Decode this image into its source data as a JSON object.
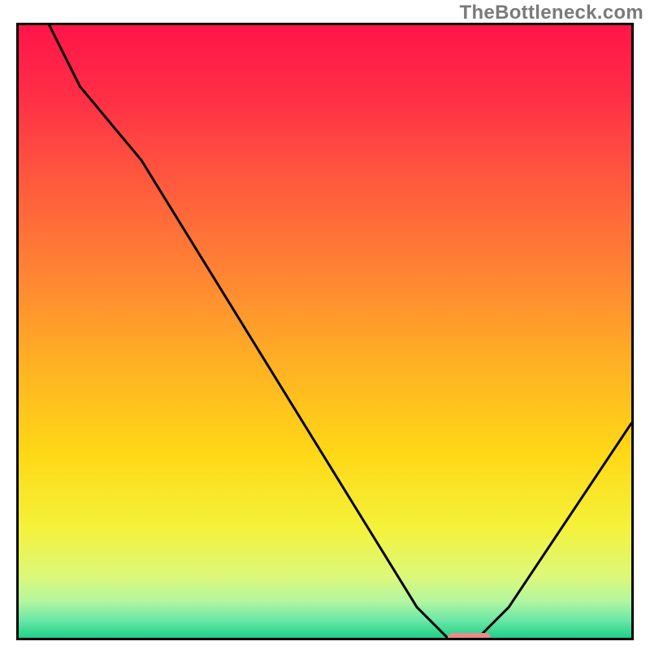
{
  "watermark": "TheBottleneck.com",
  "chart_data": {
    "type": "line",
    "title": "",
    "xlabel": "",
    "ylabel": "",
    "xlim": [
      0,
      100
    ],
    "ylim": [
      0,
      100
    ],
    "grid": false,
    "legend": false,
    "line": {
      "x": [
        5,
        10,
        20,
        65,
        70,
        75,
        80,
        100
      ],
      "y": [
        100,
        90,
        78,
        5,
        0,
        0,
        5,
        35
      ]
    },
    "marker": {
      "x_range": [
        70,
        77
      ],
      "y": 0,
      "color": "#e98b87"
    },
    "gradient": {
      "stops": [
        {
          "pos": 0.0,
          "color": "#ff1549"
        },
        {
          "pos": 0.12,
          "color": "#ff2f46"
        },
        {
          "pos": 0.25,
          "color": "#ff583e"
        },
        {
          "pos": 0.4,
          "color": "#ff8334"
        },
        {
          "pos": 0.55,
          "color": "#ffb024"
        },
        {
          "pos": 0.7,
          "color": "#ffd816"
        },
        {
          "pos": 0.82,
          "color": "#f4f23a"
        },
        {
          "pos": 0.9,
          "color": "#dcf87a"
        },
        {
          "pos": 0.94,
          "color": "#b3f6a0"
        },
        {
          "pos": 0.97,
          "color": "#6ee8a6"
        },
        {
          "pos": 1.0,
          "color": "#1fd08a"
        }
      ]
    }
  }
}
